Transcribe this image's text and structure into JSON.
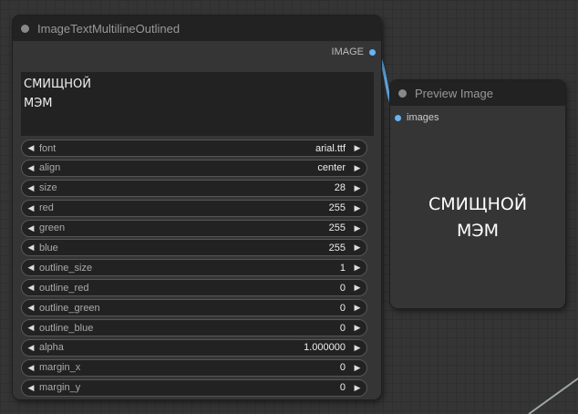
{
  "node_text": {
    "title": "ImageTextMultilineOutlined",
    "output_label": "IMAGE",
    "text": "СМИЩНОЙ\nМЭМ",
    "widgets": [
      {
        "label": "font",
        "value": "arial.ttf"
      },
      {
        "label": "align",
        "value": "center"
      },
      {
        "label": "size",
        "value": "28"
      },
      {
        "label": "red",
        "value": "255"
      },
      {
        "label": "green",
        "value": "255"
      },
      {
        "label": "blue",
        "value": "255"
      },
      {
        "label": "outline_size",
        "value": "1"
      },
      {
        "label": "outline_red",
        "value": "0"
      },
      {
        "label": "outline_green",
        "value": "0"
      },
      {
        "label": "outline_blue",
        "value": "0"
      },
      {
        "label": "alpha",
        "value": "1.000000"
      },
      {
        "label": "margin_x",
        "value": "0"
      },
      {
        "label": "margin_y",
        "value": "0"
      }
    ],
    "arrow_left": "◀",
    "arrow_right": "▶"
  },
  "node_preview": {
    "title": "Preview Image",
    "input_label": "images",
    "image_text": "СМИЩНОЙ\nМЭМ"
  },
  "colors": {
    "link": "#64b5f6",
    "canvas": "#353535",
    "node_title": "#222222"
  }
}
